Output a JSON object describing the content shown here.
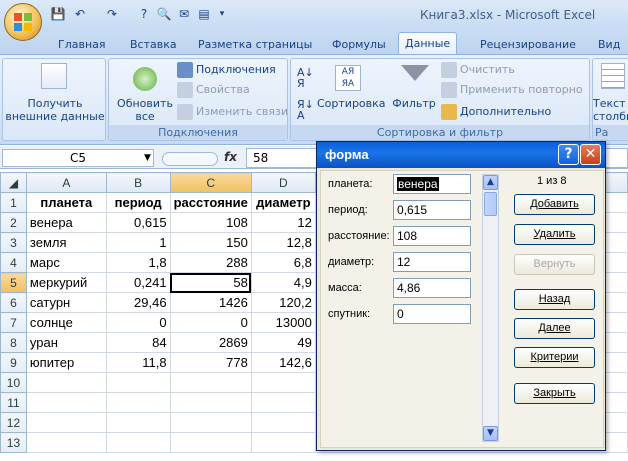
{
  "app_title": "Книга3.xlsx - Microsoft Excel",
  "tabs": [
    "Главная",
    "Вставка",
    "Разметка страницы",
    "Формулы",
    "Данные",
    "Рецензирование",
    "Вид"
  ],
  "active_tab": "Данные",
  "ribbon": {
    "get_external_data": "Получить внешние данные",
    "refresh_all": "Обновить все",
    "connections": "Подключения",
    "properties": "Свойства",
    "edit_links": "Изменить связи",
    "group_connections": "Подключения",
    "sort": "Сортировка",
    "filter": "Фильтр",
    "clear": "Очистить",
    "reapply": "Применить повторно",
    "advanced": "Дополнительно",
    "group_sort_filter": "Сортировка и фильтр",
    "text_to_columns": "Текст по столбца",
    "group_data_tools": "Ра"
  },
  "namebox": "C5",
  "formula_value": "58",
  "columns": [
    "A",
    "B",
    "C",
    "D"
  ],
  "rows": [
    {
      "n": "1",
      "cells": [
        "планета",
        "период",
        "расстояние",
        "диаметр"
      ]
    },
    {
      "n": "2",
      "cells": [
        "венера",
        "0,615",
        "108",
        "12"
      ]
    },
    {
      "n": "3",
      "cells": [
        "земля",
        "1",
        "150",
        "12,8"
      ]
    },
    {
      "n": "4",
      "cells": [
        "марс",
        "1,8",
        "288",
        "6,8"
      ]
    },
    {
      "n": "5",
      "cells": [
        "меркурий",
        "0,241",
        "58",
        "4,9"
      ]
    },
    {
      "n": "6",
      "cells": [
        "сатурн",
        "29,46",
        "1426",
        "120,2"
      ]
    },
    {
      "n": "7",
      "cells": [
        "солнце",
        "0",
        "0",
        "13000"
      ]
    },
    {
      "n": "8",
      "cells": [
        "уран",
        "84",
        "2869",
        "49"
      ]
    },
    {
      "n": "9",
      "cells": [
        "юпитер",
        "11,8",
        "778",
        "142,6"
      ]
    },
    {
      "n": "10",
      "cells": [
        "",
        "",
        "",
        ""
      ]
    },
    {
      "n": "11",
      "cells": [
        "",
        "",
        "",
        ""
      ]
    },
    {
      "n": "12",
      "cells": [
        "",
        "",
        "",
        ""
      ]
    },
    {
      "n": "13",
      "cells": [
        "",
        "",
        "",
        ""
      ]
    }
  ],
  "dialog": {
    "title": "форма",
    "record": "1 из 8",
    "fields": [
      {
        "label": "планета:",
        "value": "венера"
      },
      {
        "label": "период:",
        "value": "0,615"
      },
      {
        "label": "расстояние:",
        "value": "108"
      },
      {
        "label": "диаметр:",
        "value": "12"
      },
      {
        "label": "масса:",
        "value": "4,86"
      },
      {
        "label": "спутник:",
        "value": "0"
      }
    ],
    "buttons": {
      "add": "Добавить",
      "delete": "Удалить",
      "restore": "Вернуть",
      "prev": "Назад",
      "next": "Далее",
      "criteria": "Критерии",
      "close": "Закрыть"
    }
  },
  "colors": {
    "accent": "#15428b",
    "titlebar": "#0a5fd8",
    "selection": "#f1c15f"
  }
}
